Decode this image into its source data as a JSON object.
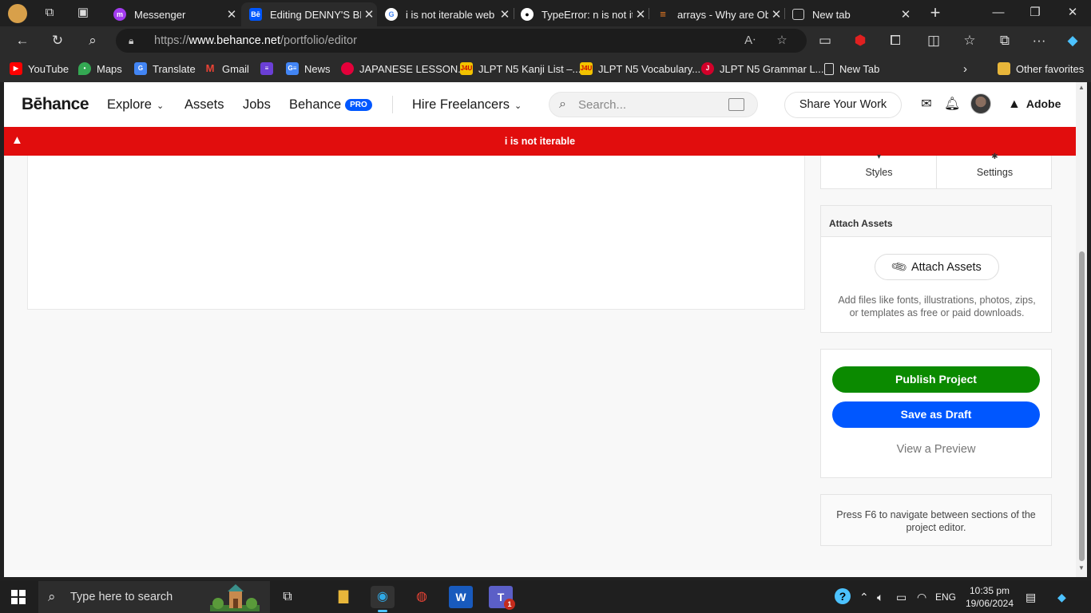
{
  "browser": {
    "tabs": [
      {
        "title": "Messenger",
        "icon": "messenger-icon",
        "color": "#a33bf0"
      },
      {
        "title": "Editing DENNY'S BR",
        "icon": "behance-icon",
        "color": "#0057ff"
      },
      {
        "title": "i is not iterable web",
        "icon": "google-icon",
        "color": "#ffffff"
      },
      {
        "title": "TypeError: n is not it",
        "icon": "github-icon",
        "color": "#ffffff"
      },
      {
        "title": "arrays - Why are Ob",
        "icon": "stackoverflow-icon",
        "color": "#f48024"
      },
      {
        "title": "New tab",
        "icon": "newtab-icon",
        "color": "#cccccc"
      }
    ],
    "url_prefix": "https://",
    "url_domain": "www.behance.net",
    "url_path": "/portfolio/editor",
    "favorites": [
      {
        "label": "YouTube",
        "icon": "youtube-icon",
        "color": "#ff0000"
      },
      {
        "label": "Maps",
        "icon": "maps-icon",
        "color": "#34a853"
      },
      {
        "label": "Translate",
        "icon": "translate-icon",
        "color": "#4285f4"
      },
      {
        "label": "Gmail",
        "icon": "gmail-icon",
        "color": "#ea4335"
      },
      {
        "label": "",
        "icon": "list-icon",
        "color": "#6b3fd6"
      },
      {
        "label": "News",
        "icon": "news-icon",
        "color": "#4285f4"
      },
      {
        "label": "JAPANESE LESSON...",
        "icon": "lesson-icon",
        "color": "#e4003a"
      },
      {
        "label": "JLPT N5 Kanji List –...",
        "icon": "jlpt-icon",
        "color": "#f2c200"
      },
      {
        "label": "JLPT N5 Vocabulary...",
        "icon": "jlpt-icon",
        "color": "#f2c200"
      },
      {
        "label": "JLPT N5 Grammar L...",
        "icon": "jlpt-red-icon",
        "color": "#d3002a"
      },
      {
        "label": "New Tab",
        "icon": "page-icon",
        "color": "#dddddd"
      }
    ],
    "other_favorites": "Other favorites"
  },
  "header": {
    "logo": "Bēhance",
    "nav": {
      "explore": "Explore",
      "assets": "Assets",
      "jobs": "Jobs",
      "behance": "Behance",
      "pro": "PRO",
      "hire": "Hire Freelancers"
    },
    "search_placeholder": "Search...",
    "share": "Share Your Work",
    "adobe": "Adobe"
  },
  "error": {
    "message": "i is not iterable"
  },
  "sidebar": {
    "styles": "Styles",
    "settings": "Settings",
    "attach_title": "Attach Assets",
    "attach_button": "Attach Assets",
    "attach_desc": "Add files like fonts, illustrations, photos, zips, or templates as free or paid downloads.",
    "publish": "Publish Project",
    "draft": "Save as Draft",
    "preview": "View a Preview",
    "hint": "Press F6 to navigate between sections of the project editor."
  },
  "taskbar": {
    "search_placeholder": "Type here to search",
    "language": "ENG",
    "time": "10:35 pm",
    "date": "19/06/2024",
    "teams_badge": "1"
  },
  "colors": {
    "error_red": "#e10d0d",
    "publish_green": "#0b8a00",
    "draft_blue": "#0057ff"
  }
}
